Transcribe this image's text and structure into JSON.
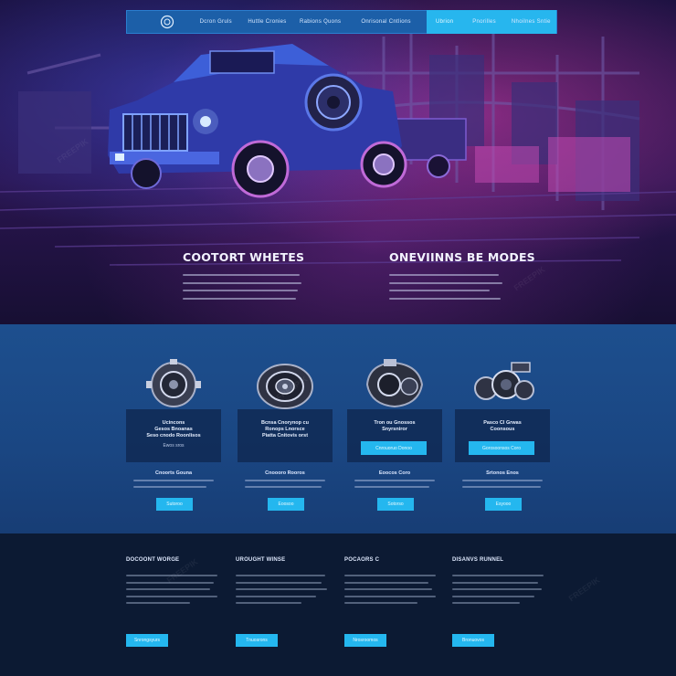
{
  "nav": {
    "items": [
      "Dcron Gruls",
      "Huttle Cronies",
      "Rabions Quons",
      "Onrisonal Cntlions",
      "Ubrion",
      "Pnorilles",
      "Nhoilnes Sntie"
    ],
    "active_index": 3
  },
  "hero": {
    "left_title": "COOTORT WHETES",
    "right_title": "ONEVIINNS BE MODES"
  },
  "products": [
    {
      "title": "Ucincons\nGesos Bnoanas\nSeso cnodo Roonlisos",
      "subtitle": "Ewos sros",
      "cta": "",
      "sub_heading": "Cnoorts Gouna",
      "more": "Sutoroo"
    },
    {
      "title": "Bcnsa Cnorynop cu\nRonops Lnorsce\nPiatta Cnitovis orst",
      "subtitle": "",
      "cta": "",
      "sub_heading": "Cnoooro Rooros",
      "more": "Eoosoo"
    },
    {
      "title": "Tron ou Gnossos\nSnyrsniror",
      "subtitle": "",
      "cta": "Cnrouoruo Donoo",
      "sub_heading": "Eoocos Coro",
      "more": "Sotorso"
    },
    {
      "title": "Pasco Cl Grwas\nCoonsous",
      "subtitle": "",
      "cta": "Gorosoonsos Coro",
      "sub_heading": "Srtonos Enos",
      "more": "Esyooo"
    }
  ],
  "footer": [
    {
      "title": "DOCOONT WORGE",
      "btn": "Snrongsyurs"
    },
    {
      "title": "UROUGHT WINSE",
      "btn": "Tnuosrons"
    },
    {
      "title": "POCAORS C",
      "btn": "Nrosroomos"
    },
    {
      "title": "DISANVS RUNNEL",
      "btn": "Bronuovos"
    }
  ],
  "watermark": "FREEPIK",
  "colors": {
    "accent": "#24b7ef",
    "nav": "#1c5fa8",
    "products_bg": "#1d4f8e",
    "footer_bg": "#0c1a33"
  }
}
